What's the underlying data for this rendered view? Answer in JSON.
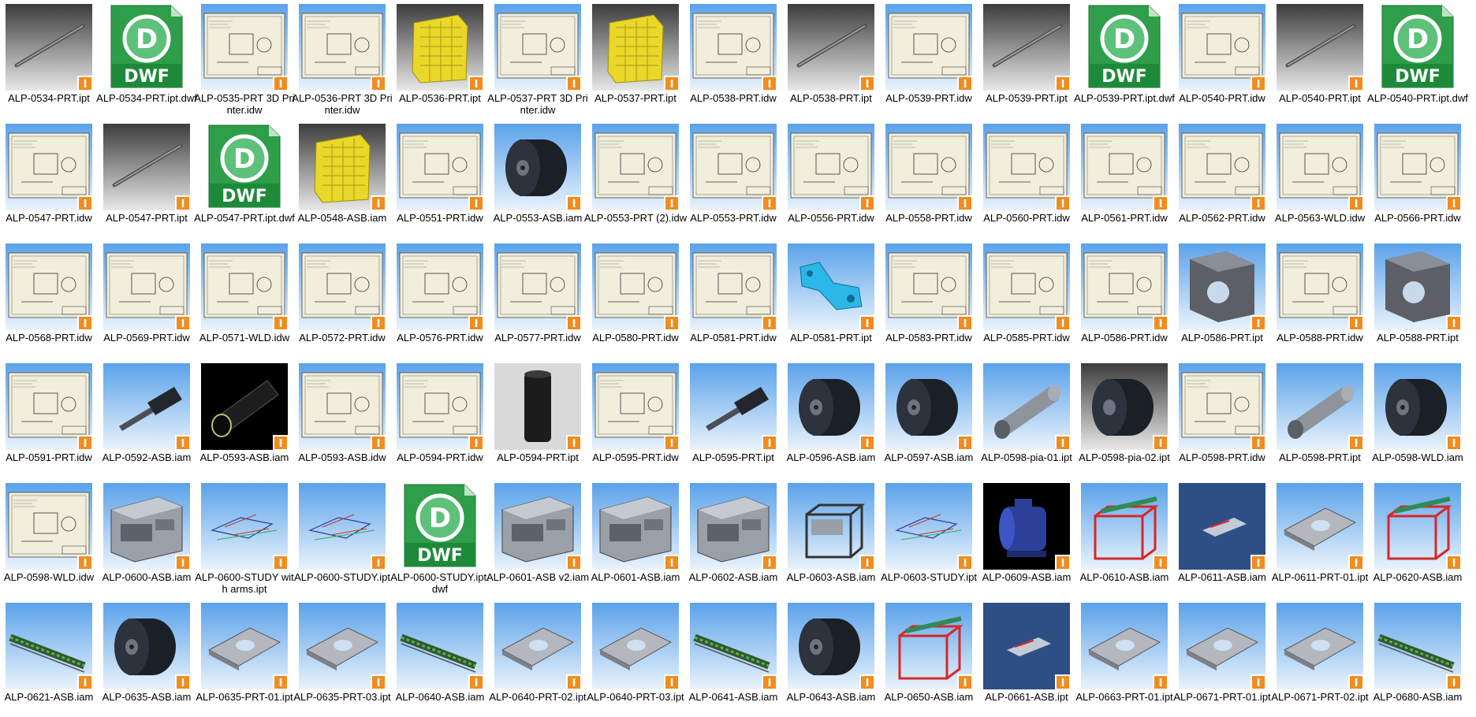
{
  "files": [
    {
      "name": "ALP-0534-PRT.ipt",
      "thumb": "part",
      "inventor": true
    },
    {
      "name": "ALP-0534-PRT.ipt.dwf",
      "thumb": "dwf",
      "inventor": false
    },
    {
      "name": "ALP-0535-PRT 3D Printer.idw",
      "thumb": "drawing",
      "inventor": true
    },
    {
      "name": "ALP-0536-PRT 3D Printer.idw",
      "thumb": "drawing",
      "inventor": true
    },
    {
      "name": "ALP-0536-PRT.ipt",
      "thumb": "yellow",
      "inventor": true
    },
    {
      "name": "ALP-0537-PRT 3D Printer.idw",
      "thumb": "drawing",
      "inventor": true
    },
    {
      "name": "ALP-0537-PRT.ipt",
      "thumb": "yellow",
      "inventor": true
    },
    {
      "name": "ALP-0538-PRT.idw",
      "thumb": "drawing",
      "inventor": true
    },
    {
      "name": "ALP-0538-PRT.ipt",
      "thumb": "part",
      "inventor": true
    },
    {
      "name": "ALP-0539-PRT.idw",
      "thumb": "drawing",
      "inventor": true
    },
    {
      "name": "ALP-0539-PRT.ipt",
      "thumb": "part",
      "inventor": true
    },
    {
      "name": "ALP-0539-PRT.ipt.dwf",
      "thumb": "dwf",
      "inventor": false
    },
    {
      "name": "ALP-0540-PRT.idw",
      "thumb": "drawing",
      "inventor": true
    },
    {
      "name": "ALP-0540-PRT.ipt",
      "thumb": "part",
      "inventor": true
    },
    {
      "name": "ALP-0540-PRT.ipt.dwf",
      "thumb": "dwf",
      "inventor": false
    },
    {
      "name": "ALP-0547-PRT.idw",
      "thumb": "drawing",
      "inventor": true
    },
    {
      "name": "ALP-0547-PRT.ipt",
      "thumb": "part",
      "inventor": true
    },
    {
      "name": "ALP-0547-PRT.ipt.dwf",
      "thumb": "dwf",
      "inventor": false
    },
    {
      "name": "ALP-0548-ASB.iam",
      "thumb": "yellow",
      "inventor": true
    },
    {
      "name": "ALP-0551-PRT.idw",
      "thumb": "drawing",
      "inventor": true
    },
    {
      "name": "ALP-0553-ASB.iam",
      "thumb": "roller",
      "inventor": true
    },
    {
      "name": "ALP-0553-PRT (2).idw",
      "thumb": "drawing",
      "inventor": true
    },
    {
      "name": "ALP-0553-PRT.idw",
      "thumb": "drawing",
      "inventor": true
    },
    {
      "name": "ALP-0556-PRT.idw",
      "thumb": "drawing",
      "inventor": true
    },
    {
      "name": "ALP-0558-PRT.idw",
      "thumb": "drawing",
      "inventor": true
    },
    {
      "name": "ALP-0560-PRT.idw",
      "thumb": "drawing",
      "inventor": true
    },
    {
      "name": "ALP-0561-PRT.idw",
      "thumb": "drawing",
      "inventor": true
    },
    {
      "name": "ALP-0562-PRT.idw",
      "thumb": "drawing",
      "inventor": true
    },
    {
      "name": "ALP-0563-WLD.idw",
      "thumb": "drawing",
      "inventor": true
    },
    {
      "name": "ALP-0566-PRT.idw",
      "thumb": "drawing",
      "inventor": true
    },
    {
      "name": "ALP-0568-PRT.idw",
      "thumb": "drawing",
      "inventor": true
    },
    {
      "name": "ALP-0569-PRT.idw",
      "thumb": "drawing",
      "inventor": true
    },
    {
      "name": "ALP-0571-WLD.idw",
      "thumb": "drawing",
      "inventor": true
    },
    {
      "name": "ALP-0572-PRT.idw",
      "thumb": "drawing",
      "inventor": true
    },
    {
      "name": "ALP-0576-PRT.idw",
      "thumb": "drawing",
      "inventor": true
    },
    {
      "name": "ALP-0577-PRT.idw",
      "thumb": "drawing",
      "inventor": true
    },
    {
      "name": "ALP-0580-PRT.idw",
      "thumb": "drawing",
      "inventor": true
    },
    {
      "name": "ALP-0581-PRT.idw",
      "thumb": "drawing",
      "inventor": true
    },
    {
      "name": "ALP-0581-PRT.ipt",
      "thumb": "cyan",
      "inventor": true
    },
    {
      "name": "ALP-0583-PRT.idw",
      "thumb": "drawing",
      "inventor": true
    },
    {
      "name": "ALP-0585-PRT.idw",
      "thumb": "drawing",
      "inventor": true
    },
    {
      "name": "ALP-0586-PRT.idw",
      "thumb": "drawing",
      "inventor": true
    },
    {
      "name": "ALP-0586-PRT.ipt",
      "thumb": "block",
      "inventor": true
    },
    {
      "name": "ALP-0588-PRT.idw",
      "thumb": "drawing",
      "inventor": true
    },
    {
      "name": "ALP-0588-PRT.ipt",
      "thumb": "block",
      "inventor": true
    },
    {
      "name": "ALP-0591-PRT.idw",
      "thumb": "drawing",
      "inventor": true
    },
    {
      "name": "ALP-0592-ASB.iam",
      "thumb": "shaft",
      "inventor": true
    },
    {
      "name": "ALP-0593-ASB.iam",
      "thumb": "blacktube",
      "inventor": true
    },
    {
      "name": "ALP-0593-ASB.idw",
      "thumb": "drawing",
      "inventor": true
    },
    {
      "name": "ALP-0594-PRT.idw",
      "thumb": "drawing",
      "inventor": true
    },
    {
      "name": "ALP-0594-PRT.ipt",
      "thumb": "sleeve",
      "inventor": true
    },
    {
      "name": "ALP-0595-PRT.idw",
      "thumb": "drawing",
      "inventor": true
    },
    {
      "name": "ALP-0595-PRT.ipt",
      "thumb": "shaft",
      "inventor": true
    },
    {
      "name": "ALP-0596-ASB.iam",
      "thumb": "roller",
      "inventor": true
    },
    {
      "name": "ALP-0597-ASB.iam",
      "thumb": "roller",
      "inventor": true
    },
    {
      "name": "ALP-0598-pia-01.ipt",
      "thumb": "greytube",
      "inventor": true
    },
    {
      "name": "ALP-0598-pia-02.ipt",
      "thumb": "rollergrey",
      "inventor": true
    },
    {
      "name": "ALP-0598-PRT.idw",
      "thumb": "drawing",
      "inventor": true
    },
    {
      "name": "ALP-0598-PRT.ipt",
      "thumb": "greytube",
      "inventor": true
    },
    {
      "name": "ALP-0598-WLD.iam",
      "thumb": "roller",
      "inventor": true
    },
    {
      "name": "ALP-0598-WLD.idw",
      "thumb": "drawing",
      "inventor": true
    },
    {
      "name": "ALP-0600-ASB.iam",
      "thumb": "machine",
      "inventor": true
    },
    {
      "name": "ALP-0600-STUDY with arms.ipt",
      "thumb": "wire",
      "inventor": true
    },
    {
      "name": "ALP-0600-STUDY.ipt",
      "thumb": "wire",
      "inventor": true
    },
    {
      "name": "ALP-0600-STUDY.ipt.dwf",
      "thumb": "dwf",
      "inventor": false
    },
    {
      "name": "ALP-0601-ASB v2.iam",
      "thumb": "machine",
      "inventor": true
    },
    {
      "name": "ALP-0601-ASB.iam",
      "thumb": "machine",
      "inventor": true
    },
    {
      "name": "ALP-0602-ASB.iam",
      "thumb": "machine",
      "inventor": true
    },
    {
      "name": "ALP-0603-ASB.iam",
      "thumb": "frame",
      "inventor": true
    },
    {
      "name": "ALP-0603-STUDY.ipt",
      "thumb": "wire",
      "inventor": true
    },
    {
      "name": "ALP-0609-ASB.iam",
      "thumb": "motor",
      "inventor": true
    },
    {
      "name": "ALP-0610-ASB.iam",
      "thumb": "redframe",
      "inventor": true
    },
    {
      "name": "ALP-0611-ASB.iam",
      "thumb": "darkblue",
      "inventor": true
    },
    {
      "name": "ALP-0611-PRT-01.ipt",
      "thumb": "plate",
      "inventor": true
    },
    {
      "name": "ALP-0620-ASB.iam",
      "thumb": "redframe",
      "inventor": true
    },
    {
      "name": "ALP-0621-ASB.iam",
      "thumb": "conveyor",
      "inventor": true
    },
    {
      "name": "ALP-0635-ASB.iam",
      "thumb": "roller",
      "inventor": true
    },
    {
      "name": "ALP-0635-PRT-01.ipt",
      "thumb": "plate",
      "inventor": true
    },
    {
      "name": "ALP-0635-PRT-03.ipt",
      "thumb": "plate",
      "inventor": true
    },
    {
      "name": "ALP-0640-ASB.iam",
      "thumb": "conveyor",
      "inventor": true
    },
    {
      "name": "ALP-0640-PRT-02.ipt",
      "thumb": "plate",
      "inventor": true
    },
    {
      "name": "ALP-0640-PRT-03.ipt",
      "thumb": "plate",
      "inventor": true
    },
    {
      "name": "ALP-0641-ASB.iam",
      "thumb": "conveyor",
      "inventor": true
    },
    {
      "name": "ALP-0643-ASB.iam",
      "thumb": "roller",
      "inventor": true
    },
    {
      "name": "ALP-0650-ASB.iam",
      "thumb": "redframe",
      "inventor": true
    },
    {
      "name": "ALP-0661-ASB.ipt",
      "thumb": "darkblue",
      "inventor": true
    },
    {
      "name": "ALP-0663-PRT-01.ipt",
      "thumb": "plate",
      "inventor": true
    },
    {
      "name": "ALP-0671-PRT-01.ipt",
      "thumb": "plate",
      "inventor": true
    },
    {
      "name": "ALP-0671-PRT-02.ipt",
      "thumb": "plate",
      "inventor": true
    },
    {
      "name": "ALP-0680-ASB.iam",
      "thumb": "conveyor",
      "inventor": true
    }
  ],
  "dwf_icon_text": "DWF",
  "inventor_badge_glyph": "I",
  "colors": {
    "sky_top": "#5aa2ea",
    "sky_bottom": "#eaf3fc",
    "grey_top": "#3c3c3c",
    "grey_bottom": "#e8e8e8",
    "drawing_paper": "#f1eedc",
    "dwf_green": "#1d8a3a",
    "inventor_orange": "#f28c1e"
  }
}
